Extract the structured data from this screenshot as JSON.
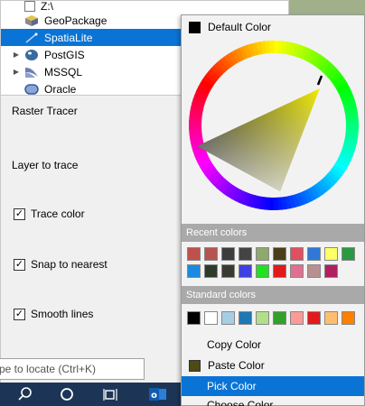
{
  "browser": {
    "items": [
      {
        "label": "Z:\\",
        "icon": "folder-icon",
        "selected": false,
        "expandable": false
      },
      {
        "label": "GeoPackage",
        "icon": "geopackage-icon",
        "selected": false,
        "expandable": false
      },
      {
        "label": "SpatiaLite",
        "icon": "spatialite-icon",
        "selected": true,
        "expandable": false
      },
      {
        "label": "PostGIS",
        "icon": "postgis-icon",
        "selected": false,
        "expandable": true
      },
      {
        "label": "MSSQL",
        "icon": "mssql-icon",
        "selected": false,
        "expandable": true
      },
      {
        "label": "Oracle",
        "icon": "oracle-icon",
        "selected": false,
        "expandable": false
      }
    ]
  },
  "panel": {
    "title": "Raster Tracer",
    "layer_label": "Layer to trace",
    "trace_color": "Trace color",
    "snap_to_nearest": "Snap to nearest",
    "smooth_lines": "Smooth lines"
  },
  "locator": {
    "placeholder": "pe to locate (Ctrl+K)"
  },
  "popup": {
    "default_color": "Default Color",
    "recent_header": "Recent colors",
    "standard_header": "Standard colors",
    "copy_color": "Copy Color",
    "paste_color": "Paste Color",
    "pick_color": "Pick Color",
    "choose_color": "Choose Color",
    "recent_colors": [
      "#c0504d",
      "#b85450",
      "#3c3c3c",
      "#444444",
      "#8fa86c",
      "#4a3e18",
      "#e05060",
      "#3078d8",
      "#ffff66",
      "#2a9a40",
      "#1a8ae0",
      "#2e3a2a",
      "#3a3a30",
      "#4040e0",
      "#22e022",
      "#e01a1a",
      "#e07090",
      "#b89090",
      "#b02060"
    ],
    "standard_colors": [
      "#000000",
      "#ffffff",
      "#a6cee3",
      "#1f78b4",
      "#b2df8a",
      "#33a02c",
      "#fb9a99",
      "#e31a1c",
      "#fdbf6f",
      "#ff7f00"
    ]
  },
  "colors": {
    "selected_bg": "#0a74d6",
    "taskbar": "#1c3557",
    "paste_swatch": "#4f4a12"
  }
}
